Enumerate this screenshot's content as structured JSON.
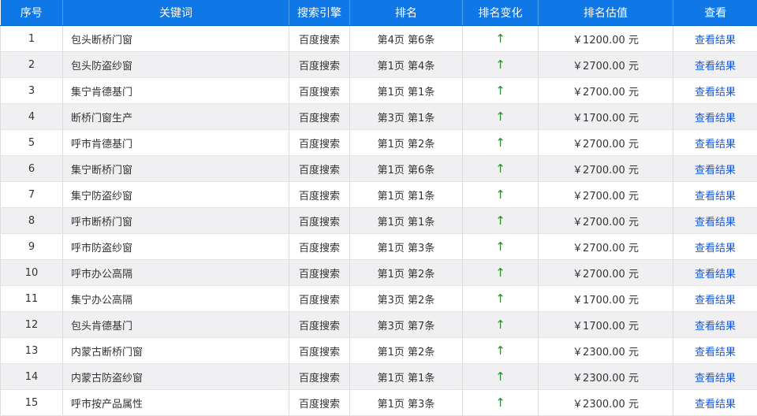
{
  "table": {
    "headers": [
      "序号",
      "关键词",
      "搜索引擎",
      "排名",
      "排名变化",
      "排名估值",
      "查看"
    ],
    "rows": [
      {
        "no": "1",
        "keyword": "包头断桥门窗",
        "engine": "百度搜索",
        "rank": "第4页 第6条",
        "change": "↑",
        "value": "￥1200.00 元",
        "link": "查看结果"
      },
      {
        "no": "2",
        "keyword": "包头防盗纱窗",
        "engine": "百度搜索",
        "rank": "第1页 第4条",
        "change": "↑",
        "value": "￥2700.00 元",
        "link": "查看结果"
      },
      {
        "no": "3",
        "keyword": "集宁肯德基门",
        "engine": "百度搜索",
        "rank": "第1页 第1条",
        "change": "↑",
        "value": "￥2700.00 元",
        "link": "查看结果"
      },
      {
        "no": "4",
        "keyword": "断桥门窗生产",
        "engine": "百度搜索",
        "rank": "第3页 第1条",
        "change": "↑",
        "value": "￥1700.00 元",
        "link": "查看结果"
      },
      {
        "no": "5",
        "keyword": "呼市肯德基门",
        "engine": "百度搜索",
        "rank": "第1页 第2条",
        "change": "↑",
        "value": "￥2700.00 元",
        "link": "查看结果"
      },
      {
        "no": "6",
        "keyword": "集宁断桥门窗",
        "engine": "百度搜索",
        "rank": "第1页 第6条",
        "change": "↑",
        "value": "￥2700.00 元",
        "link": "查看结果"
      },
      {
        "no": "7",
        "keyword": "集宁防盗纱窗",
        "engine": "百度搜索",
        "rank": "第1页 第1条",
        "change": "↑",
        "value": "￥2700.00 元",
        "link": "查看结果"
      },
      {
        "no": "8",
        "keyword": "呼市断桥门窗",
        "engine": "百度搜索",
        "rank": "第1页 第1条",
        "change": "↑",
        "value": "￥2700.00 元",
        "link": "查看结果"
      },
      {
        "no": "9",
        "keyword": "呼市防盗纱窗",
        "engine": "百度搜索",
        "rank": "第1页 第3条",
        "change": "↑",
        "value": "￥2700.00 元",
        "link": "查看结果"
      },
      {
        "no": "10",
        "keyword": "呼市办公高隔",
        "engine": "百度搜索",
        "rank": "第1页 第2条",
        "change": "↑",
        "value": "￥2700.00 元",
        "link": "查看结果"
      },
      {
        "no": "11",
        "keyword": "集宁办公高隔",
        "engine": "百度搜索",
        "rank": "第3页 第2条",
        "change": "↑",
        "value": "￥1700.00 元",
        "link": "查看结果"
      },
      {
        "no": "12",
        "keyword": "包头肯德基门",
        "engine": "百度搜索",
        "rank": "第3页 第7条",
        "change": "↑",
        "value": "￥1700.00 元",
        "link": "查看结果"
      },
      {
        "no": "13",
        "keyword": "内蒙古断桥门窗",
        "engine": "百度搜索",
        "rank": "第1页 第2条",
        "change": "↑",
        "value": "￥2300.00 元",
        "link": "查看结果"
      },
      {
        "no": "14",
        "keyword": "内蒙古防盗纱窗",
        "engine": "百度搜索",
        "rank": "第1页 第1条",
        "change": "↑",
        "value": "￥2300.00 元",
        "link": "查看结果"
      },
      {
        "no": "15",
        "keyword": "呼市按产品属性",
        "engine": "百度搜索",
        "rank": "第1页 第3条",
        "change": "↑",
        "value": "￥2300.00 元",
        "link": "查看结果"
      }
    ]
  },
  "colors": {
    "header_bg": "#0f78e6",
    "header_text": "#ffffff",
    "row_alt_bg": "#f0f0f2",
    "change_up": "#2e8b2e",
    "link": "#1a57d6"
  }
}
